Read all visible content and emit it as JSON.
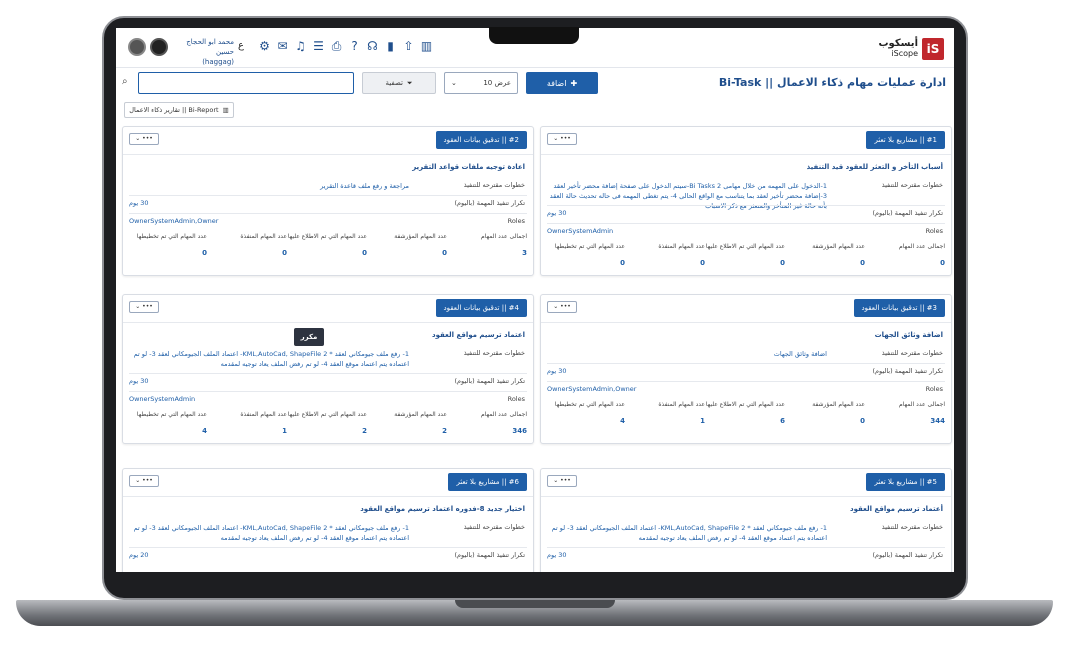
{
  "app": {
    "logo_ar": "أيسكوب",
    "logo_en": "iScope",
    "user_name": "محمد ابو الحجاج حسين",
    "user_handle": "(haggag)",
    "lang_toggle": "ع"
  },
  "header": {
    "title": "ادارة عمليات مهام ذكاء الاعمال || Bi-Task",
    "add_label": "اضافة",
    "per_page_label": "عرض 10",
    "filter_label": "تصفية",
    "search_placeholder": "",
    "report_select": "Bi-Report || تقارير ذكاء الاعمال"
  },
  "badge": "مكرر",
  "labels": {
    "steps": "خطوات مقترحه للتنفيذ",
    "repeat": "تكرار تنفيذ المهمة (باليوم)",
    "roles": "Roles",
    "total": "اجمالى عدد المهام",
    "archived": "عدد المهام المؤرشفة",
    "viewed": "عدد المهام التي تم الاطلاع عليها",
    "executed": "عدد المهام المنفذة",
    "planned": "عدد المهام التي تم تخطيطها"
  },
  "cards": [
    {
      "tag": "#1 || مشاريع بلا تعثر",
      "title": "أسباب التأخر و التعثر للعقود قيد التنفيذ",
      "steps": "1-الدخول على المهمه من خلال مهامى Bi Tasks 2-سيتم الدخول على صفحة إضافة محضر تأخير لعقد 3-إضافة محضر تأخير لعقد بما يتناسب مع الواقع الحالى 4- يتم تغطى المهمه فى حاله تحديث حالة العقد بأنه حالة غير المتأخر والمتعثر مع ذكر الاسباب",
      "repeat": "30 يوم",
      "roles": "OwnerSystemAdmin",
      "stats": [
        "0",
        "0",
        "0",
        "0",
        "0"
      ]
    },
    {
      "tag": "#2 || تدقيق بيانات العقود",
      "title": "اعادة توجيه ملفات قواعد التقرير",
      "steps": "مراجعة و رفع ملف قاعدة التقرير",
      "repeat": "30 يوم",
      "roles": "OwnerSystemAdmin,Owner",
      "stats": [
        "3",
        "0",
        "0",
        "0",
        "0"
      ]
    },
    {
      "tag": "#3 || تدقيق بيانات العقود",
      "title": "اضافة وثائق الجهات",
      "steps": "اضافة وثائق الجهات",
      "repeat": "30 يوم",
      "roles": "OwnerSystemAdmin,Owner",
      "stats": [
        "344",
        "0",
        "6",
        "1",
        "4"
      ]
    },
    {
      "tag": "#4 || تدقيق بيانات العقود",
      "title": "اعتماد ترسيم مواقع العقود",
      "steps": "1- رفع ملف جيومكاني لعقد * KML,AutoCad, ShapeFile 2- اعتماد الملف الجيومكاني لعقد 3- لو تم اعتماده يتم اعتماد موقع العقد 4- لو تم رفض الملف يعاد توجيه لمقدمه",
      "repeat": "30 يوم",
      "roles": "OwnerSystemAdmin",
      "stats": [
        "346",
        "2",
        "2",
        "1",
        "4"
      ]
    },
    {
      "tag": "#5 || مشاريع بلا تعثر",
      "title": "أعتماد ترسيم مواقع العقود",
      "steps": "1- رفع ملف جيومكاني لعقد * KML,AutoCad, ShapeFile 2- اعتماد الملف الجيومكاني لعقد 3- لو تم اعتماده يتم اعتماد موقع العقد 4- لو تم رفض الملف يعاد توجيه لمقدمه",
      "repeat": "30 يوم",
      "roles": "",
      "stats": []
    },
    {
      "tag": "#6 || مشاريع بلا تعثر",
      "title": "اختيار جديد 8-فدوره اعتماد ترسيم مواقع العقود",
      "steps": "1- رفع ملف جيومكاني لعقد * KML,AutoCad, ShapeFile 2- اعتماد الملف الجيومكاني لعقد 3- لو تم اعتماده يتم اعتماد موقع العقد 4- لو تم رفض الملف يعاد توجيه لمقدمه",
      "repeat": "20 يوم",
      "roles": "",
      "stats": []
    }
  ]
}
